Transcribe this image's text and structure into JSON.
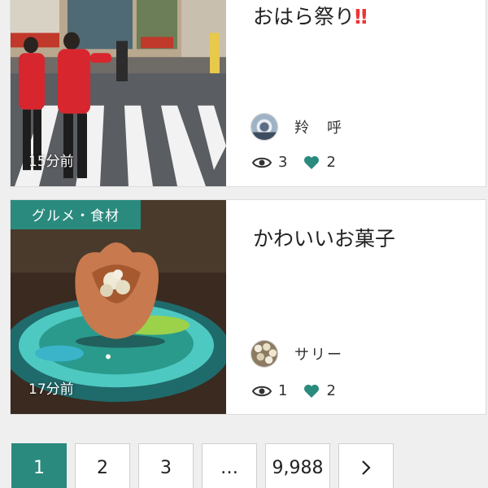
{
  "posts": [
    {
      "title": "おはら祭り",
      "title_emoji": "‼",
      "timestamp": "15分前",
      "author": "羚　呼",
      "views": "3",
      "likes": "2"
    },
    {
      "category": "グルメ・食材",
      "title": "かわいいお菓子",
      "timestamp": "17分前",
      "author": "サリー",
      "views": "1",
      "likes": "2"
    }
  ],
  "pagination": {
    "pages": [
      "1",
      "2",
      "3",
      "…",
      "9,988"
    ],
    "next_icon": "chevron-right-icon",
    "active_page": "1"
  },
  "colors": {
    "accent": "#2a8a7e",
    "title_emoji": "#e33333"
  },
  "icons": {
    "views": "eye-icon",
    "likes": "heart-icon"
  }
}
